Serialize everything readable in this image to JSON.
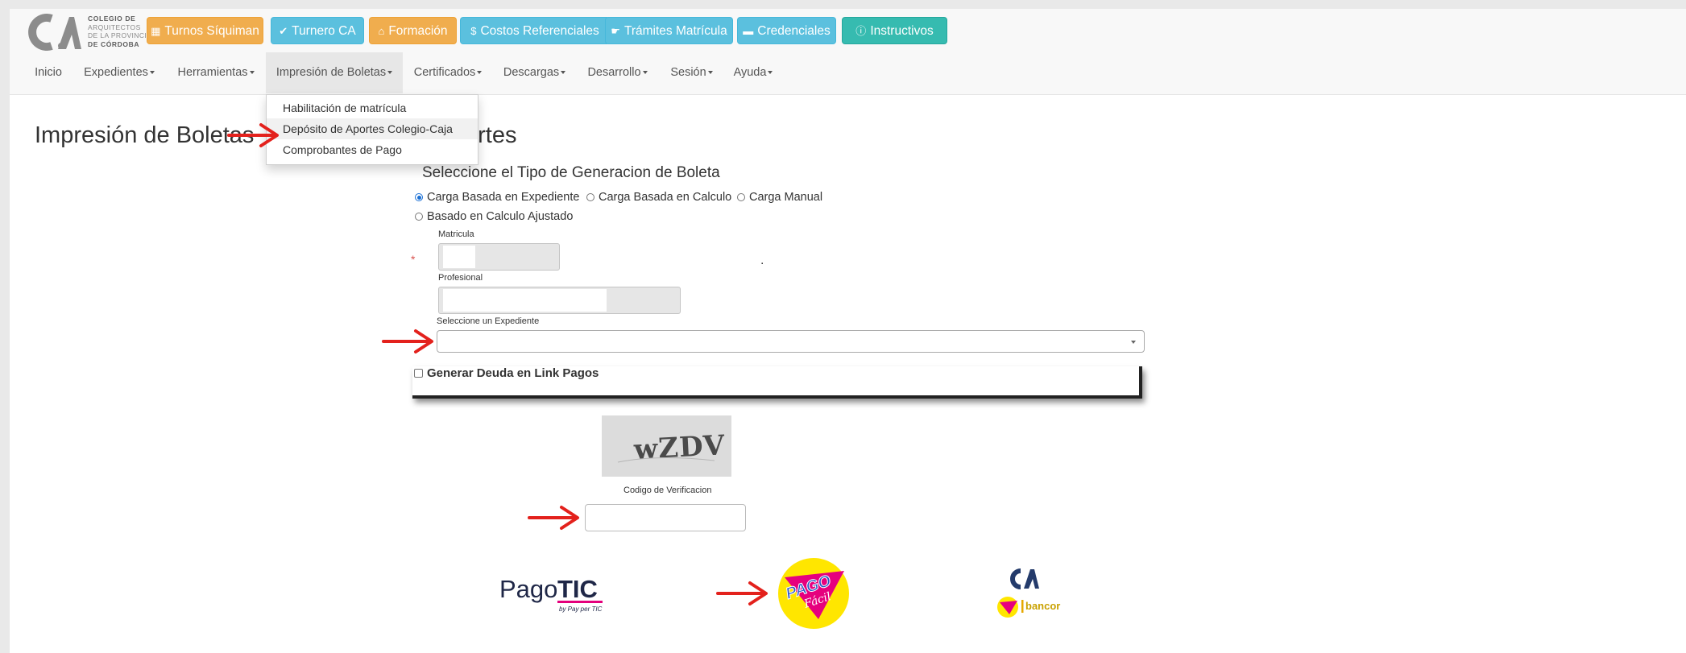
{
  "logo": {
    "letters": "CA",
    "lines": [
      "COLEGIO DE",
      "ARQUITECTOS",
      "DE LA PROVINCIA",
      "DE CÓRDOBA"
    ]
  },
  "quick_buttons": [
    {
      "label": "Turnos Síquiman",
      "icon": "grid-icon",
      "color": "#f0ad4e"
    },
    {
      "label": "Turnero CA",
      "icon": "check-circle-icon",
      "color": "#5bc0de"
    },
    {
      "label": "Formación",
      "icon": "graduation-cap-icon",
      "color": "#f0ad4e"
    },
    {
      "label": "Costos Referenciales",
      "icon": "dollar-icon",
      "color": "#5bc0de"
    },
    {
      "label": "Trámites Matrícula",
      "icon": "hand-icon",
      "color": "#5bc0de"
    },
    {
      "label": "Credenciales",
      "icon": "credit-card-icon",
      "color": "#5bc0de"
    },
    {
      "label": "Instructivos",
      "icon": "info-icon",
      "color": "#36bbb0"
    }
  ],
  "nav": [
    {
      "label": "Inicio"
    },
    {
      "label": "Expedientes"
    },
    {
      "label": "Herramientas"
    },
    {
      "label": "Impresión de Boletas"
    },
    {
      "label": "Certificados"
    },
    {
      "label": "Descargas"
    },
    {
      "label": "Desarrollo"
    },
    {
      "label": "Sesión"
    },
    {
      "label": "Ayuda"
    }
  ],
  "dropdown": {
    "items": [
      {
        "label": "Habilitación de matrícula"
      },
      {
        "label": "Depósito de Aportes Colegio-Caja"
      },
      {
        "label": "Comprobantes de Pago"
      }
    ]
  },
  "page": {
    "heading_start": "Impresión de Boletas",
    "heading_end": "ortes"
  },
  "form": {
    "title": "Seleccione el Tipo de Generacion de Boleta",
    "radios": [
      {
        "label": "Carga Basada en Expediente",
        "checked": true
      },
      {
        "label": "Carga Basada en Calculo",
        "checked": false
      },
      {
        "label": "Carga Manual",
        "checked": false
      },
      {
        "label": "Basado en Calculo Ajustado",
        "checked": false
      }
    ],
    "matricula_label": "Matricula",
    "profesional_label": "Profesional",
    "expediente_label": "Seleccione un Expediente",
    "required_mark": "*",
    "stray_dot": ".",
    "checkbox_label": "Generar Deuda en Link Pagos",
    "captcha_text": "wZDV",
    "captcha_label": "Codigo de Verificacion"
  },
  "payment_logos": {
    "pagotic": {
      "word1": "Pago",
      "word2": "TIC",
      "tagline": "by Pay per TIC"
    },
    "pagofacil": {
      "word1": "PAGO",
      "word2": "Fácil"
    },
    "ca_bancor": {
      "letters": "CA",
      "bank": "bancor"
    }
  },
  "colors": {
    "orange": "#f0ad4e",
    "blue": "#5bc0de",
    "teal": "#36bbb0",
    "annotation_red": "#e3211c"
  }
}
